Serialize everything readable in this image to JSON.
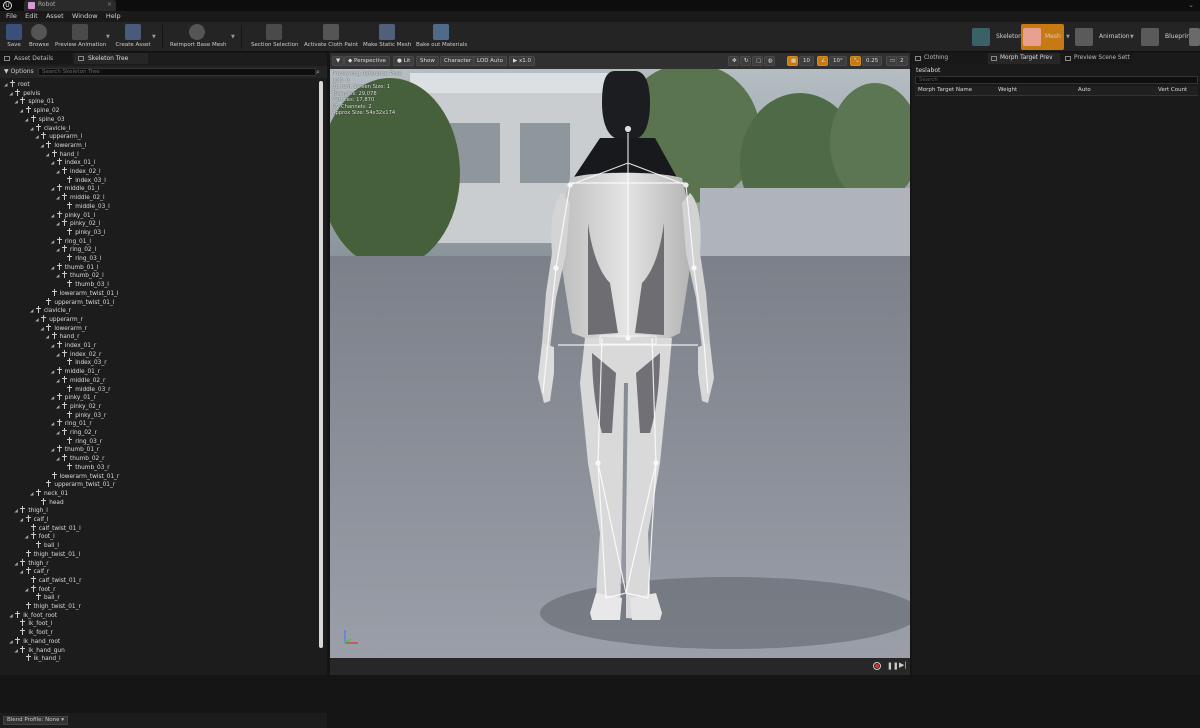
{
  "window": {
    "tab_title": "Robot",
    "corner_glyph": "⌄"
  },
  "menu": [
    "File",
    "Edit",
    "Asset",
    "Window",
    "Help"
  ],
  "toolbar": {
    "save": "Save",
    "browse": "Browse",
    "preview_animation": "Preview Animation",
    "create_asset": "Create Asset",
    "reimport": "Reimport Base Mesh",
    "section_selection": "Section Selection",
    "cloth_paint": "Activate Cloth Paint",
    "make_static": "Make Static Mesh",
    "bake_materials": "Bake out Materials"
  },
  "modes": {
    "skeleton": "Skeleton",
    "mesh": "Mesh",
    "animation": "Animation",
    "blueprint": "Blueprint"
  },
  "left_panel": {
    "tab_asset_details": "Asset Details",
    "tab_skeleton_tree": "Skeleton Tree",
    "options": "Options",
    "search_placeholder": "Search Skeleton Tree",
    "blend_profile": "Blend Profile: None"
  },
  "bones": [
    {
      "name": "root",
      "depth": 0
    },
    {
      "name": "pelvis",
      "depth": 1
    },
    {
      "name": "spine_01",
      "depth": 2
    },
    {
      "name": "spine_02",
      "depth": 3
    },
    {
      "name": "spine_03",
      "depth": 4
    },
    {
      "name": "clavicle_l",
      "depth": 5
    },
    {
      "name": "upperarm_l",
      "depth": 6
    },
    {
      "name": "lowerarm_l",
      "depth": 7
    },
    {
      "name": "hand_l",
      "depth": 8
    },
    {
      "name": "index_01_l",
      "depth": 9
    },
    {
      "name": "index_02_l",
      "depth": 10
    },
    {
      "name": "index_03_l",
      "depth": 11
    },
    {
      "name": "middle_01_l",
      "depth": 9
    },
    {
      "name": "middle_02_l",
      "depth": 10
    },
    {
      "name": "middle_03_l",
      "depth": 11
    },
    {
      "name": "pinky_01_l",
      "depth": 9
    },
    {
      "name": "pinky_02_l",
      "depth": 10
    },
    {
      "name": "pinky_03_l",
      "depth": 11
    },
    {
      "name": "ring_01_l",
      "depth": 9
    },
    {
      "name": "ring_02_l",
      "depth": 10
    },
    {
      "name": "ring_03_l",
      "depth": 11
    },
    {
      "name": "thumb_01_l",
      "depth": 9
    },
    {
      "name": "thumb_02_l",
      "depth": 10
    },
    {
      "name": "thumb_03_l",
      "depth": 11
    },
    {
      "name": "lowerarm_twist_01_l",
      "depth": 8
    },
    {
      "name": "upperarm_twist_01_l",
      "depth": 7
    },
    {
      "name": "clavicle_r",
      "depth": 5
    },
    {
      "name": "upperarm_r",
      "depth": 6
    },
    {
      "name": "lowerarm_r",
      "depth": 7
    },
    {
      "name": "hand_r",
      "depth": 8
    },
    {
      "name": "index_01_r",
      "depth": 9
    },
    {
      "name": "index_02_r",
      "depth": 10
    },
    {
      "name": "index_03_r",
      "depth": 11
    },
    {
      "name": "middle_01_r",
      "depth": 9
    },
    {
      "name": "middle_02_r",
      "depth": 10
    },
    {
      "name": "middle_03_r",
      "depth": 11
    },
    {
      "name": "pinky_01_r",
      "depth": 9
    },
    {
      "name": "pinky_02_r",
      "depth": 10
    },
    {
      "name": "pinky_03_r",
      "depth": 11
    },
    {
      "name": "ring_01_r",
      "depth": 9
    },
    {
      "name": "ring_02_r",
      "depth": 10
    },
    {
      "name": "ring_03_r",
      "depth": 11
    },
    {
      "name": "thumb_01_r",
      "depth": 9
    },
    {
      "name": "thumb_02_r",
      "depth": 10
    },
    {
      "name": "thumb_03_r",
      "depth": 11
    },
    {
      "name": "lowerarm_twist_01_r",
      "depth": 8
    },
    {
      "name": "upperarm_twist_01_r",
      "depth": 7
    },
    {
      "name": "neck_01",
      "depth": 5
    },
    {
      "name": "head",
      "depth": 6
    },
    {
      "name": "thigh_l",
      "depth": 2
    },
    {
      "name": "calf_l",
      "depth": 3
    },
    {
      "name": "calf_twist_01_l",
      "depth": 4
    },
    {
      "name": "foot_l",
      "depth": 4
    },
    {
      "name": "ball_l",
      "depth": 5
    },
    {
      "name": "thigh_twist_01_l",
      "depth": 3
    },
    {
      "name": "thigh_r",
      "depth": 2
    },
    {
      "name": "calf_r",
      "depth": 3
    },
    {
      "name": "calf_twist_01_r",
      "depth": 4
    },
    {
      "name": "foot_r",
      "depth": 4
    },
    {
      "name": "ball_r",
      "depth": 5
    },
    {
      "name": "thigh_twist_01_r",
      "depth": 3
    },
    {
      "name": "ik_foot_root",
      "depth": 1
    },
    {
      "name": "ik_foot_l",
      "depth": 2
    },
    {
      "name": "ik_foot_r",
      "depth": 2
    },
    {
      "name": "ik_hand_root",
      "depth": 1
    },
    {
      "name": "ik_hand_gun",
      "depth": 2
    },
    {
      "name": "ik_hand_l",
      "depth": 3
    }
  ],
  "viewport": {
    "perspective": "Perspective",
    "lit": "Lit",
    "show": "Show",
    "character": "Character",
    "lod": "LOD Auto",
    "speed": "x1.0",
    "grid_snap": "10",
    "rot_snap": "10°",
    "scale_snap": "0.25",
    "cam_speed": "2",
    "stats": [
      "Previewing Reference Pose",
      "LOD: 0",
      "Current Screen Size: 1",
      "Triangles: 29,078",
      "Vertices: 17,870",
      "UV Channels: 2",
      "Approx Size: 54x32x174"
    ]
  },
  "right_panel": {
    "tab_clothing": "Clothing",
    "tab_morph": "Morph Target Prev",
    "tab_preview": "Preview Scene Sett",
    "mesh_name": "teslabot",
    "search_placeholder": "Search",
    "columns": [
      "Morph Target Name",
      "Weight",
      "Auto",
      "Vert Count"
    ]
  },
  "colors": {
    "accent": "#c77a14",
    "panel": "#1c1c1c",
    "floor": "#6b7280"
  }
}
